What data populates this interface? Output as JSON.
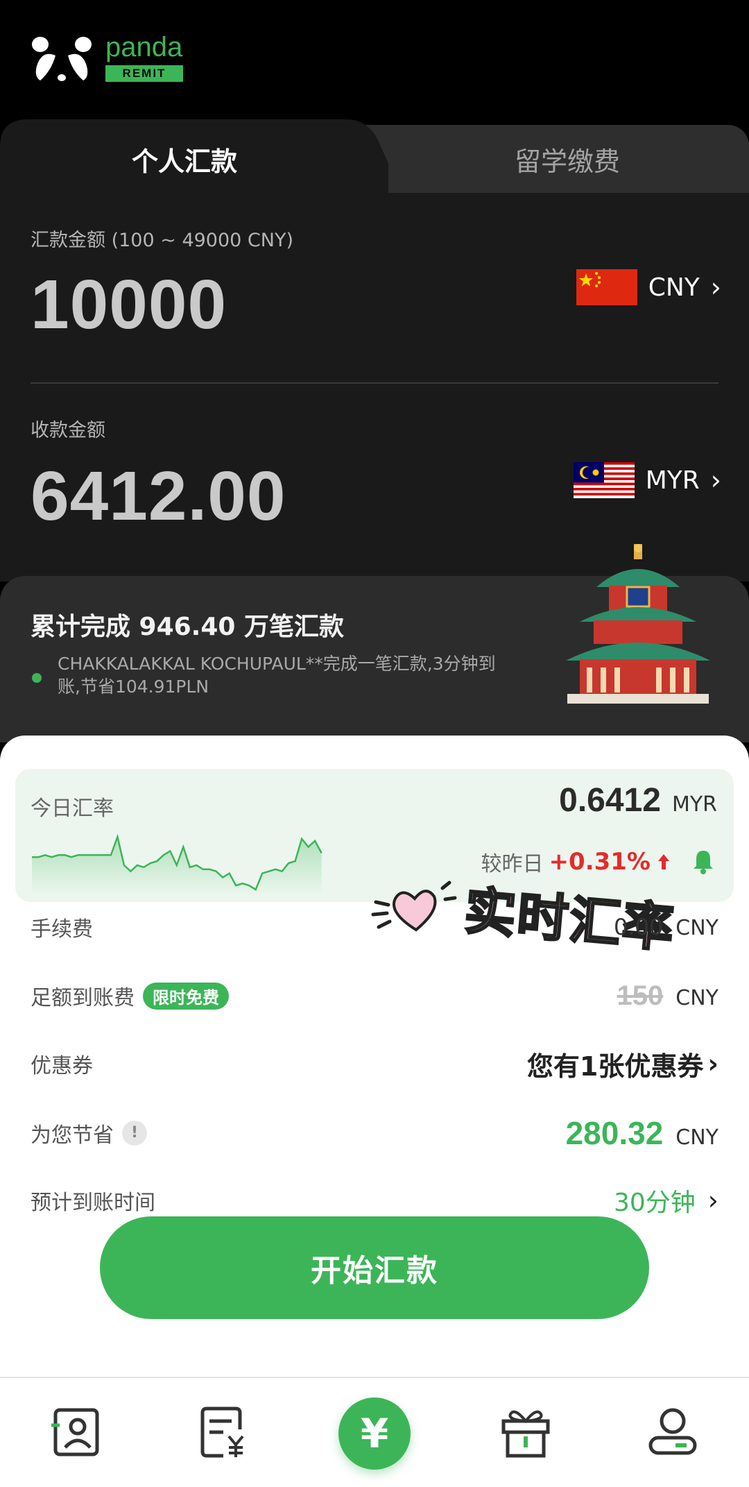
{
  "brand": {
    "name": "panda",
    "tag": "REMIT"
  },
  "tabs": [
    {
      "label": "个人汇款",
      "active": true
    },
    {
      "label": "留学缴费",
      "active": false
    }
  ],
  "send": {
    "label": "汇款金额 (100 ~ 49000 CNY)",
    "amount": "10000",
    "currency": "CNY"
  },
  "receive": {
    "label": "收款金额",
    "amount": "6412.00",
    "currency": "MYR"
  },
  "stats": {
    "title": "累计完成 946.40 万笔汇款",
    "message": "CHAKKALAKKAL KOCHUPAUL**完成一笔汇款,3分钟到账,节省104.91PLN"
  },
  "rate": {
    "title": "今日汇率",
    "value": "0.6412",
    "unit": "MYR",
    "change_label": "较昨日",
    "change": "+0.31%",
    "sparkline": [
      0.639,
      0.639,
      0.6391,
      0.639,
      0.6391,
      0.6391,
      0.639,
      0.6391,
      0.6391,
      0.6391,
      0.6391,
      0.6391,
      0.6391,
      0.64,
      0.6386,
      0.6383,
      0.6386,
      0.6385,
      0.6387,
      0.6388,
      0.6391,
      0.6393,
      0.6386,
      0.6395,
      0.6385,
      0.6386,
      0.6384,
      0.6384,
      0.6383,
      0.638,
      0.6382,
      0.6376,
      0.6377,
      0.6376,
      0.6374,
      0.6382,
      0.6383,
      0.6384,
      0.6383,
      0.6387,
      0.6388,
      0.6399,
      0.6395,
      0.6398,
      0.6392
    ]
  },
  "sticker": "实时汇率",
  "rows": {
    "fee": {
      "label": "手续费",
      "value": "0.00",
      "unit": "CNY"
    },
    "full_arrival": {
      "label": "足额到账费",
      "badge": "限时免费",
      "value": "150",
      "unit": "CNY"
    },
    "coupon": {
      "label": "优惠券",
      "value": "您有1张优惠券"
    },
    "saving": {
      "label": "为您节省",
      "value": "280.32",
      "unit": "CNY"
    },
    "eta": {
      "label": "预计到账时间",
      "value": "30分钟"
    }
  },
  "start_button": "开始汇款",
  "nav": {
    "items": [
      "recipients-icon",
      "orders-icon",
      "remit-icon",
      "gift-icon",
      "profile-icon"
    ],
    "center_glyph": "¥"
  },
  "colors": {
    "accent": "#3cb558",
    "up": "#e52b2b",
    "dark_bg": "#1a1a1a"
  }
}
